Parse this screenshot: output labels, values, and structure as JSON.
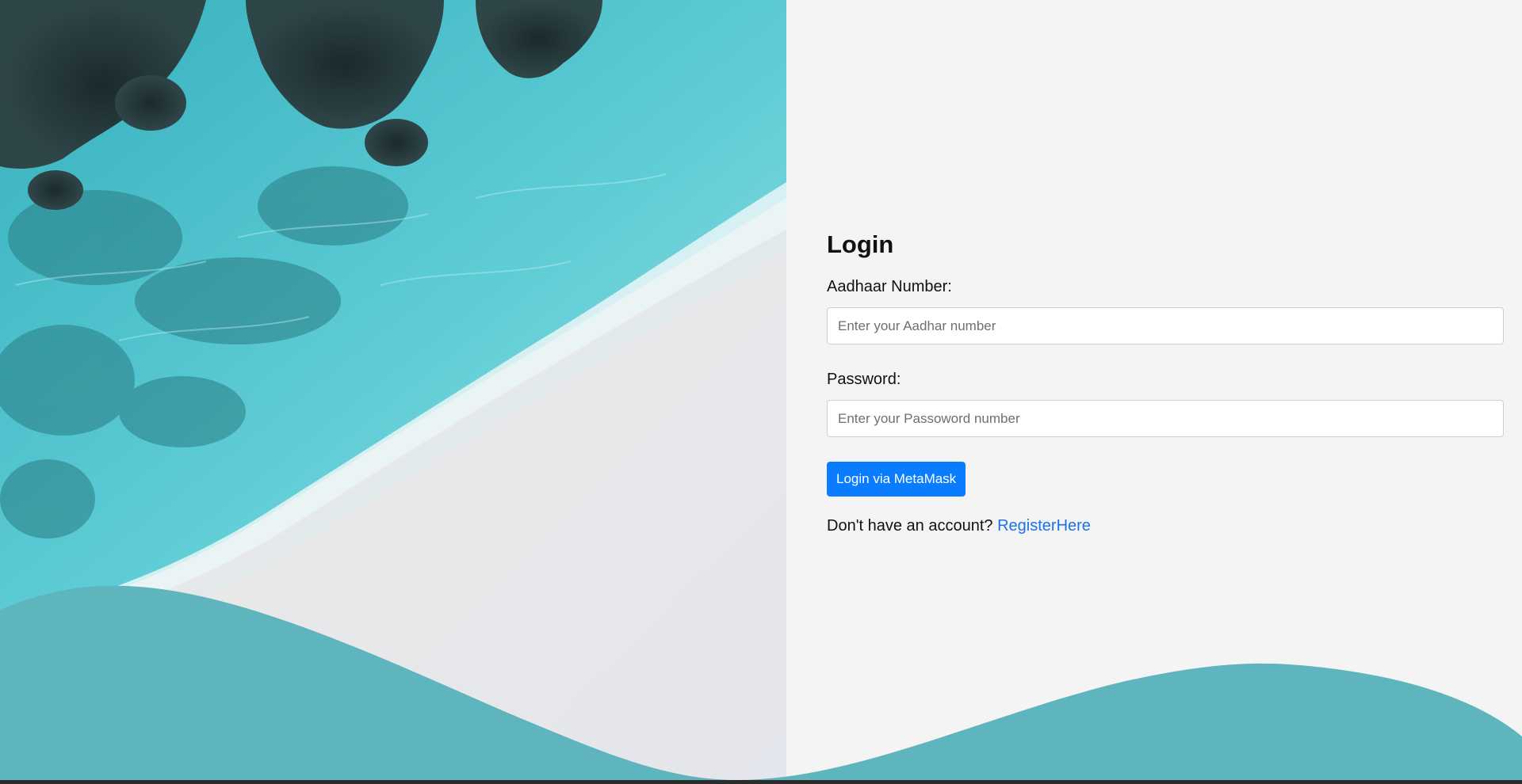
{
  "login": {
    "title": "Login",
    "aadhaar_label": "Aadhaar Number:",
    "aadhaar_placeholder": "Enter your Aadhar number",
    "aadhaar_value": "",
    "password_label": "Password:",
    "password_placeholder": "Enter your Passoword number",
    "password_value": "",
    "submit_label": "Login via MetaMask",
    "register_prompt": "Don't have an account?",
    "register_link": "RegisterHere"
  },
  "colors": {
    "background": "#f4f4f4",
    "button": "#0a7cff",
    "link": "#1a73e8",
    "wave": "#5eb5bd"
  },
  "hero_image": {
    "icon": "beach-aerial-photo"
  }
}
